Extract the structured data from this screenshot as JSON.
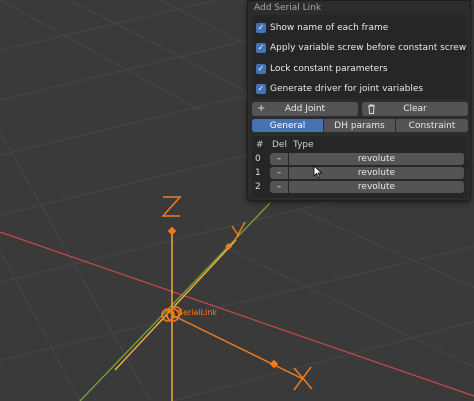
{
  "viewport": {
    "object_label": "SerialLink",
    "axis_labels": {
      "z": "Z",
      "y": "Y",
      "x": "X"
    },
    "colors": {
      "background": "#3a3a3a",
      "grid": "#474747",
      "x_axis": "#c04848",
      "y_axis": "#7aa33a",
      "object_orange": "#f27b1a",
      "object_yellow": "#f0b43a"
    }
  },
  "panel": {
    "title": "Add Serial Link",
    "options": [
      {
        "label": "Show name of each frame",
        "checked": true
      },
      {
        "label": "Apply variable screw before constant screw",
        "checked": true
      },
      {
        "label": "Lock constant parameters",
        "checked": true
      },
      {
        "label": "Generate driver for joint variables",
        "checked": true
      }
    ],
    "add_joint": {
      "icon": "plus-icon",
      "label": "Add Joint"
    },
    "clear": {
      "icon": "trash-icon",
      "label": "Clear"
    },
    "tabs": [
      {
        "label": "General",
        "active": true
      },
      {
        "label": "DH params",
        "active": false
      },
      {
        "label": "Constraint",
        "active": false
      }
    ],
    "table": {
      "headers": {
        "index": "#",
        "del": "Del",
        "type": "Type"
      },
      "rows": [
        {
          "index": "0",
          "del": "–",
          "type": "revolute"
        },
        {
          "index": "1",
          "del": "–",
          "type": "revolute"
        },
        {
          "index": "2",
          "del": "–",
          "type": "revolute"
        }
      ]
    },
    "colors": {
      "accent": "#4772b3",
      "button": "#545454",
      "panel": "#2c2c2c"
    }
  }
}
